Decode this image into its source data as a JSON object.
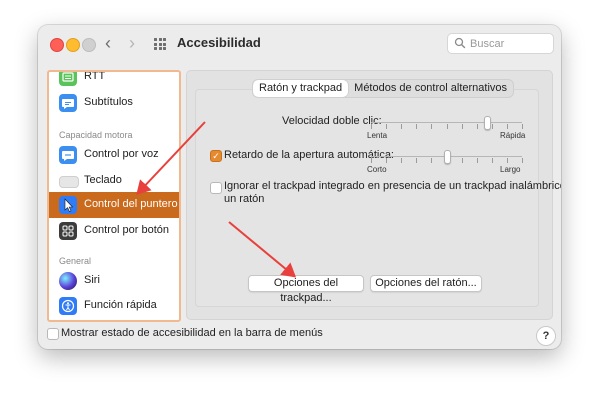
{
  "window": {
    "title": "Accesibilidad"
  },
  "search": {
    "placeholder": "Buscar"
  },
  "sidebar": {
    "items": [
      {
        "label": "RTT",
        "icon": "rtt-icon"
      },
      {
        "label": "Subtítulos",
        "icon": "captions-icon"
      },
      {
        "label": "Control por voz",
        "icon": "voice-control-icon"
      },
      {
        "label": "Teclado",
        "icon": "keyboard-icon"
      },
      {
        "label": "Control del puntero",
        "icon": "pointer-icon",
        "selected": true
      },
      {
        "label": "Control por botón",
        "icon": "switch-control-icon"
      },
      {
        "label": "Siri",
        "icon": "siri-icon"
      },
      {
        "label": "Función rápida",
        "icon": "shortcut-icon"
      }
    ],
    "sections": {
      "motor": "Capacidad motora",
      "general": "General"
    }
  },
  "tabs": [
    {
      "label": "Ratón y trackpad",
      "active": true
    },
    {
      "label": "Métodos de control alternativos",
      "active": false
    }
  ],
  "double_click": {
    "label": "Velocidad doble clic:",
    "min_label": "Lenta",
    "max_label": "Rápida",
    "value": 0.77
  },
  "spring_loading": {
    "label": "Retardo de la apertura automática:",
    "checked": true,
    "min_label": "Corto",
    "max_label": "Largo",
    "value": 0.5
  },
  "ignore_trackpad": {
    "label_line1": "Ignorar el trackpad integrado en presencia de un trackpad inalámbrico o",
    "label_line2": "un ratón",
    "checked": false
  },
  "buttons": {
    "trackpad_options": "Opciones del trackpad...",
    "mouse_options": "Opciones del ratón..."
  },
  "footer": {
    "status_label": "Mostrar estado de accesibilidad en la barra de menús",
    "checked": false,
    "help": "?"
  },
  "colors": {
    "accent": "#ca6a1c",
    "annotation": "#e8403c",
    "sidebar_border": "#f0b98f"
  }
}
